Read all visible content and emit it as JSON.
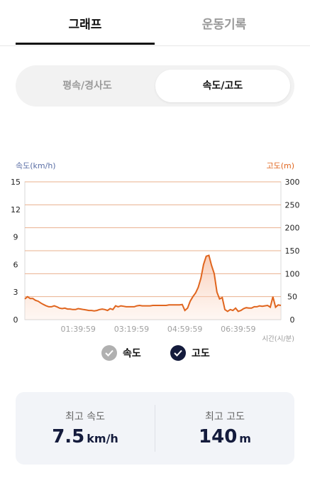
{
  "tabs": {
    "graph": "그래프",
    "record": "운동기록"
  },
  "segment": {
    "slope": "평속/경사도",
    "speed_alt": "속도/고도"
  },
  "chart": {
    "left_axis_title": "속도(km/h)",
    "right_axis_title": "고도(m)",
    "x_unit": "시간(시/분)",
    "colors": {
      "speed": "#5a6ea5",
      "altitude": "#e0651e",
      "fill": "#fbd6c2"
    }
  },
  "legend": {
    "speed": "속도",
    "altitude": "고도"
  },
  "stats": {
    "max_speed_label": "최고 속도",
    "max_speed_value": "7.5",
    "max_speed_unit": "km/h",
    "max_alt_label": "최고 고도",
    "max_alt_value": "140",
    "max_alt_unit": "m"
  },
  "chart_data": {
    "type": "area",
    "ylabel_left": "속도(km/h)",
    "ylabel_right": "고도(m)",
    "xlabel": "시간(시/분)",
    "y_left_ticks": [
      "0",
      "3",
      "6",
      "9",
      "12",
      "15"
    ],
    "y_right_ticks": [
      "0",
      "50",
      "100",
      "150",
      "200",
      "250",
      "300"
    ],
    "ylim_left": [
      0,
      15
    ],
    "ylim_right": [
      0,
      300
    ],
    "x_tick_labels": [
      "01:39:59",
      "03:19:59",
      "04:59:59",
      "06:39:59"
    ],
    "x_tick_positions_min": [
      100,
      200,
      300,
      400
    ],
    "xlim_min": [
      0,
      480
    ],
    "series": [
      {
        "name": "고도",
        "x_min": [
          0,
          5,
          10,
          15,
          20,
          25,
          30,
          35,
          40,
          45,
          50,
          55,
          60,
          65,
          70,
          75,
          80,
          85,
          90,
          95,
          100,
          105,
          110,
          115,
          120,
          125,
          130,
          135,
          140,
          145,
          150,
          155,
          160,
          165,
          170,
          175,
          180,
          185,
          190,
          195,
          200,
          205,
          210,
          215,
          220,
          225,
          230,
          235,
          240,
          245,
          250,
          255,
          260,
          265,
          270,
          275,
          280,
          285,
          290,
          295,
          300,
          305,
          310,
          315,
          320,
          325,
          330,
          335,
          340,
          345,
          350,
          355,
          360,
          365,
          370,
          375,
          380,
          385,
          390,
          395,
          400,
          405,
          410,
          415,
          420,
          425,
          430,
          435,
          440,
          445,
          450,
          455,
          460,
          465,
          470,
          475,
          480
        ],
        "values": [
          45,
          50,
          46,
          46,
          42,
          40,
          36,
          33,
          30,
          28,
          28,
          30,
          28,
          25,
          24,
          25,
          23,
          23,
          22,
          22,
          24,
          23,
          22,
          21,
          20,
          20,
          19,
          20,
          22,
          23,
          22,
          20,
          24,
          22,
          30,
          28,
          30,
          29,
          28,
          28,
          28,
          28,
          30,
          31,
          30,
          30,
          30,
          30,
          31,
          31,
          31,
          31,
          31,
          31,
          32,
          32,
          32,
          32,
          32,
          33,
          20,
          25,
          40,
          50,
          58,
          70,
          90,
          120,
          138,
          140,
          118,
          100,
          60,
          45,
          48,
          22,
          18,
          22,
          20,
          25,
          18,
          20,
          24,
          26,
          25,
          25,
          28,
          28,
          30,
          29,
          30,
          31,
          27,
          50,
          27,
          32,
          31
        ]
      }
    ]
  }
}
